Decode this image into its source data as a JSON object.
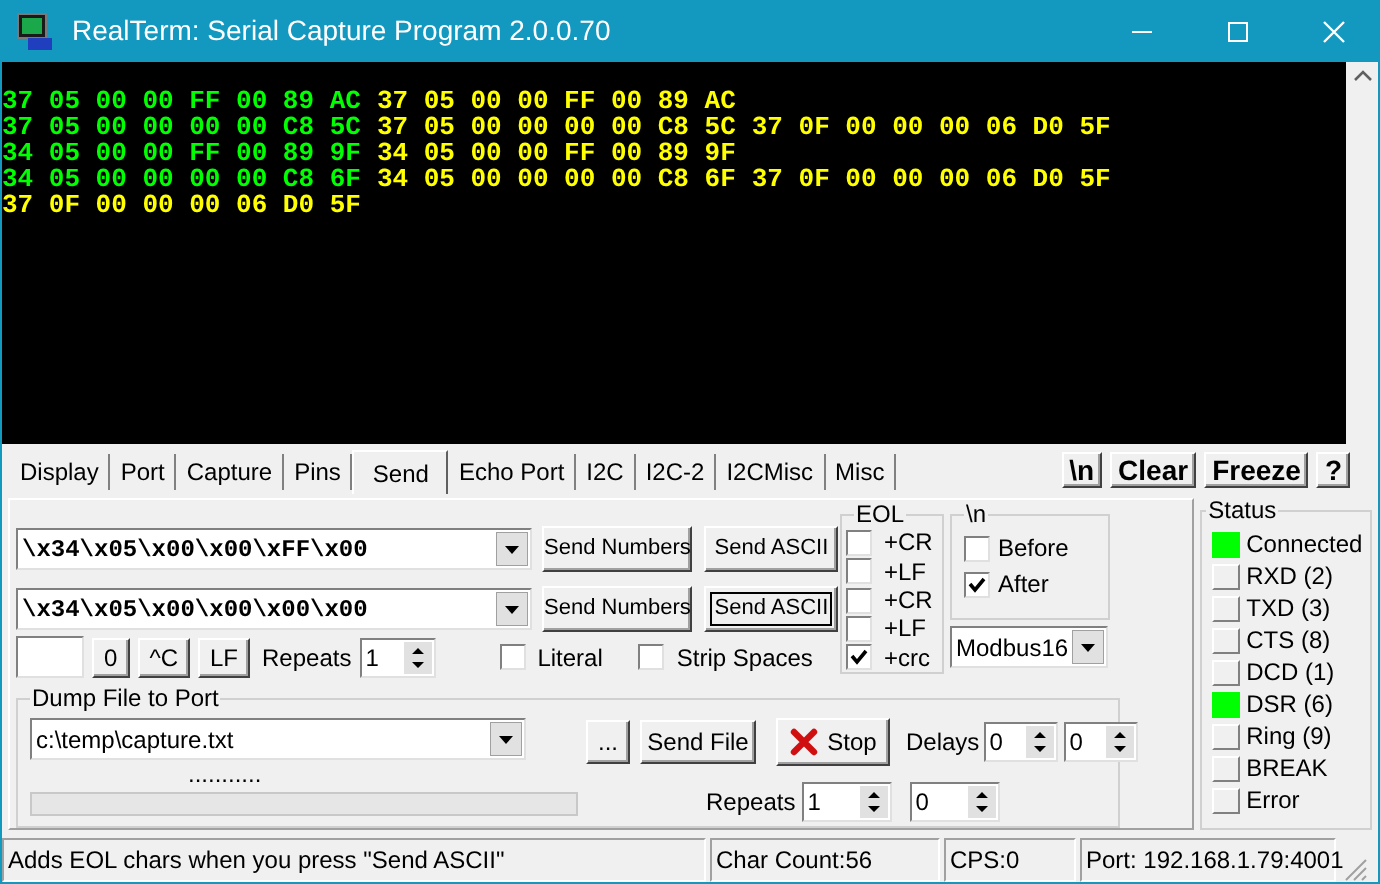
{
  "window": {
    "title": "RealTerm: Serial Capture Program 2.0.0.70"
  },
  "terminal": {
    "lines": [
      {
        "segments": [
          {
            "text": "37 05 00 00 FF 00 89 AC",
            "color": "#00ff00"
          },
          {
            "text": "37 05 00 00 FF 00 89 AC",
            "color": "#ffff00"
          }
        ]
      },
      {
        "segments": [
          {
            "text": "37 05 00 00 00 00 C8 5C",
            "color": "#00ff00"
          },
          {
            "text": "37 05 00 00 00 00 C8 5C",
            "color": "#ffff00"
          },
          {
            "text": "37 0F 00 00 00 06 D0 5F",
            "color": "#ffff00"
          }
        ]
      },
      {
        "segments": [
          {
            "text": "34 05 00 00 FF 00 89 9F",
            "color": "#00ff00"
          },
          {
            "text": "34 05 00 00 FF 00 89 9F",
            "color": "#ffff00"
          }
        ]
      },
      {
        "segments": [
          {
            "text": "34 05 00 00 00 00 C8 6F",
            "color": "#00ff00"
          },
          {
            "text": "34 05 00 00 00 00 C8 6F",
            "color": "#ffff00"
          },
          {
            "text": "37 0F 00 00 00 06 D0 5F",
            "color": "#ffff00"
          }
        ]
      },
      {
        "segments": [
          {
            "text": "37 0F 00 00 00 06 D0 5F",
            "color": "#ffff00"
          }
        ]
      }
    ]
  },
  "tabs": [
    {
      "label": "Display",
      "selected": false
    },
    {
      "label": "Port",
      "selected": false
    },
    {
      "label": "Capture",
      "selected": false
    },
    {
      "label": "Pins",
      "selected": false
    },
    {
      "label": "Send",
      "selected": true
    },
    {
      "label": "Echo Port",
      "selected": false
    },
    {
      "label": "I2C",
      "selected": false
    },
    {
      "label": "I2C-2",
      "selected": false
    },
    {
      "label": "I2CMisc",
      "selected": false
    },
    {
      "label": "Misc",
      "selected": false
    }
  ],
  "toolbar_buttons": [
    "\\n",
    "Clear",
    "Freeze",
    "?"
  ],
  "send": {
    "rows": [
      {
        "value": "\\x34\\x05\\x00\\x00\\xFF\\x00",
        "numbers_button": "Send Numbers",
        "ascii_button": "Send ASCII",
        "focused": false
      },
      {
        "value": "\\x34\\x05\\x00\\x00\\x00\\x00",
        "numbers_button": "Send Numbers",
        "ascii_button": "Send ASCII",
        "focused": true
      }
    ],
    "quick_buttons": [
      "0",
      "^C",
      "LF"
    ],
    "repeats": {
      "label": "Repeats",
      "value": "1"
    },
    "literal": {
      "label": "Literal",
      "checked": false
    },
    "strip_spaces": {
      "label": "Strip Spaces",
      "checked": false
    },
    "eol": {
      "title": "EOL",
      "options": [
        {
          "label": "+CR",
          "checked": false
        },
        {
          "label": "+LF",
          "checked": false
        },
        {
          "label": "+CR",
          "checked": false
        },
        {
          "label": "+LF",
          "checked": false
        },
        {
          "label": "+crc",
          "checked": true
        }
      ]
    },
    "newline": {
      "title": "\\n",
      "options": [
        {
          "label": "Before",
          "checked": false
        },
        {
          "label": "After",
          "checked": true
        }
      ]
    },
    "crc_type": {
      "value": "Modbus16"
    }
  },
  "dump": {
    "title": "Dump File to Port",
    "file": "c:\\temp\\capture.txt",
    "browse_button": "...",
    "send_file_button": "Send File",
    "stop_button": "Stop",
    "progress_text": "...........",
    "progress": {
      "level": 0
    },
    "delays": {
      "label": "Delays",
      "values": [
        "0",
        "0"
      ]
    },
    "repeats": {
      "label": "Repeats",
      "values": [
        "1",
        "0"
      ]
    }
  },
  "status_panel": {
    "title": "Status",
    "items": [
      {
        "label": "Connected",
        "on": true
      },
      {
        "label": "RXD (2)",
        "on": false
      },
      {
        "label": "TXD (3)",
        "on": false
      },
      {
        "label": "CTS (8)",
        "on": false
      },
      {
        "label": "DCD (1)",
        "on": false
      },
      {
        "label": "DSR (6)",
        "on": true
      },
      {
        "label": "Ring (9)",
        "on": false
      },
      {
        "label": "BREAK",
        "on": false
      },
      {
        "label": "Error",
        "on": false
      }
    ]
  },
  "status_bar": {
    "message": "Adds EOL chars when you press \"Send ASCII\"",
    "char_count": "Char Count:56",
    "cps": "CPS:0",
    "port": "Port: 192.168.1.79:4001"
  }
}
